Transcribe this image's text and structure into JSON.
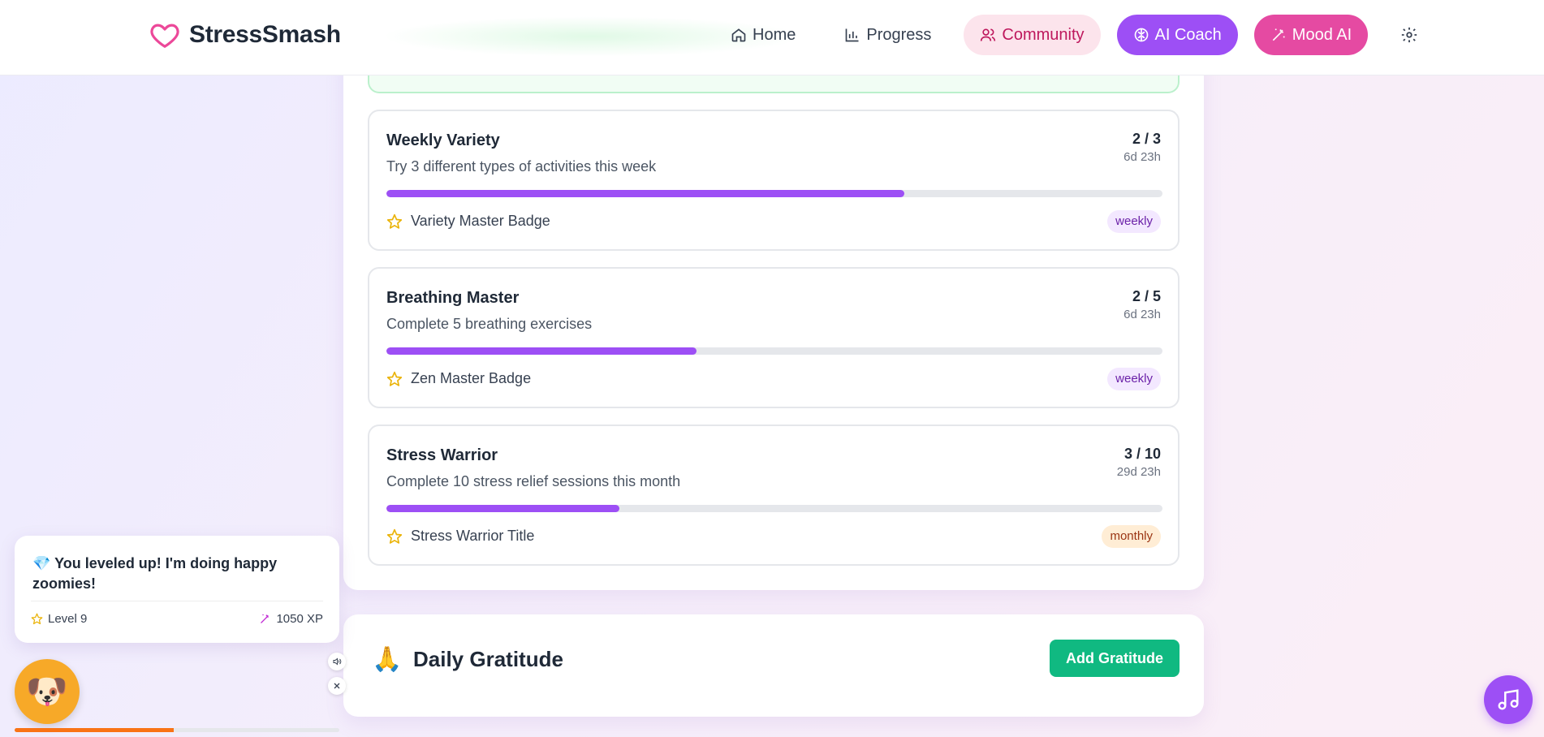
{
  "app": {
    "name": "StressSmash"
  },
  "nav": {
    "home": "Home",
    "progress": "Progress",
    "community": "Community",
    "ai_coach": "AI Coach",
    "mood_ai": "Mood AI"
  },
  "challenges": [
    {
      "title": "Weekly Variety",
      "description": "Try 3 different types of activities this week",
      "count": "2 / 3",
      "time_left": "6d 23h",
      "progress": 0.667,
      "reward": "Variety Master Badge",
      "tag": "weekly"
    },
    {
      "title": "Breathing Master",
      "description": "Complete 5 breathing exercises",
      "count": "2 / 5",
      "time_left": "6d 23h",
      "progress": 0.4,
      "reward": "Zen Master Badge",
      "tag": "weekly"
    },
    {
      "title": "Stress Warrior",
      "description": "Complete 10 stress relief sessions this month",
      "count": "3 / 10",
      "time_left": "29d 23h",
      "progress": 0.3,
      "reward": "Stress Warrior Title",
      "tag": "monthly"
    }
  ],
  "gratitude": {
    "icon": "🙏",
    "title": "Daily Gratitude",
    "button": "Add Gratitude"
  },
  "pet": {
    "icon": "🐶",
    "message_icon": "💎",
    "message": "You leveled up! I'm doing happy zoomies!",
    "level": "Level 9",
    "xp": "1050 XP",
    "xp_progress": 0.49
  },
  "colors": {
    "accent": "#9d4ff5",
    "pink": "#e54aa2",
    "green": "#10b981",
    "star": "#eab308"
  }
}
